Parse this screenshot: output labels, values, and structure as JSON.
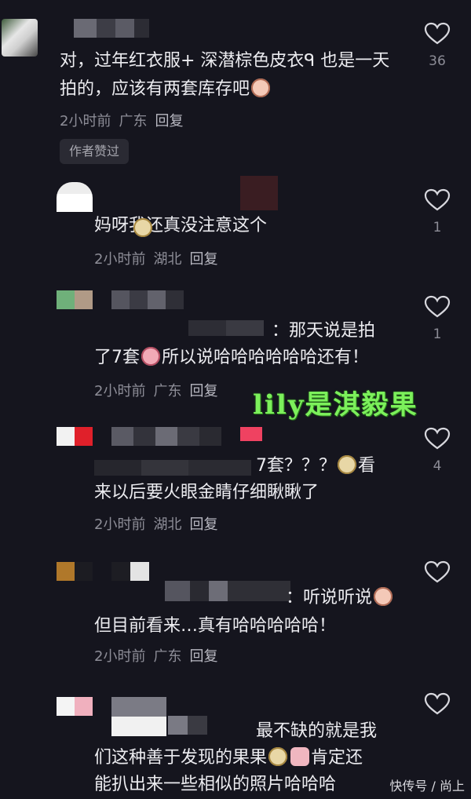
{
  "comments": [
    {
      "text": "对，过年红衣服+ 深潜棕色皮衣ᑫ 也是一天拍的，应该有两套库存吧",
      "time": "2小时前",
      "location": "广东",
      "reply_label": "回复",
      "likes": "36",
      "badge": "作者赞过"
    },
    {
      "text": "妈呀我还真没注意这个",
      "time": "2小时前",
      "location": "湖北",
      "reply_label": "回复",
      "likes": "1"
    },
    {
      "text_line1": "：那天说是拍",
      "text_line2": "了7套所以说哈哈哈哈哈哈还有！",
      "time": "2小时前",
      "location": "广东",
      "reply_label": "回复",
      "likes": "1"
    },
    {
      "text_line1": "7套？？？看",
      "text_line2": "来以后要火眼金睛仔细瞅瞅了",
      "time": "2小时前",
      "location": "湖北",
      "reply_label": "回复",
      "likes": "4"
    },
    {
      "text_line1": "：听说听说",
      "text_line2": "但目前看来…真有哈哈哈哈哈！",
      "time": "2小时前",
      "location": "广东",
      "reply_label": "回复"
    },
    {
      "text_line1": "最不缺的就是我",
      "text_line2": "们这种善于发现的果果肯定还",
      "text_line3": "能扒出来一些相似的照片哈哈哈"
    }
  ],
  "watermark": "lily是淇毅果",
  "source_mark": "快传号 / 尚上",
  "icons": {
    "like": "heart-outline-icon"
  },
  "colors": {
    "background": "#15151e",
    "watermark": "#7cf05b"
  }
}
